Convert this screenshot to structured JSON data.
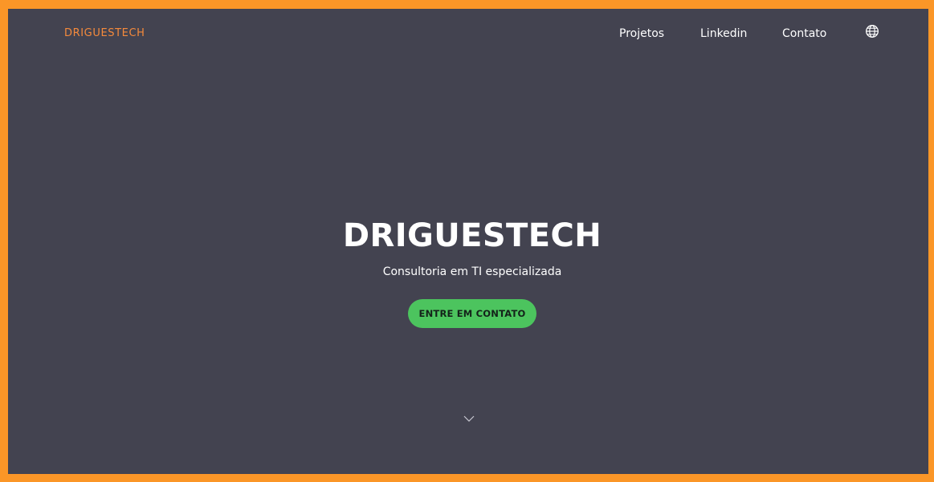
{
  "header": {
    "logo_text": "DRIGUESTECH",
    "nav": [
      {
        "label": "Projetos"
      },
      {
        "label": "Linkedin"
      },
      {
        "label": "Contato"
      }
    ],
    "language_icon": "globe-icon"
  },
  "hero": {
    "title": "DRIGUESTECH",
    "subtitle": "Consultoria em TI especializada",
    "cta_label": "ENTRE EM CONTATO",
    "scroll_icon": "chevron-down-icon"
  },
  "colors": {
    "frame_border": "#fb9627",
    "page_background": "#434350",
    "logo": "#f58a3c",
    "cta_background": "#4cc45e",
    "cta_text": "#14221a",
    "text": "#ffffff"
  }
}
